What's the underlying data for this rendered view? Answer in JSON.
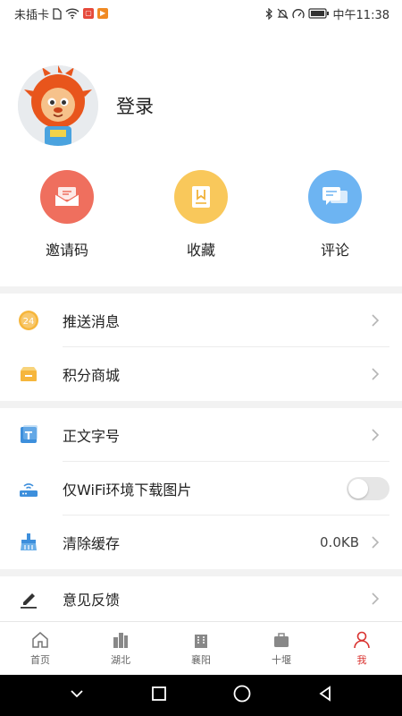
{
  "status_bar": {
    "carrier": "未插卡",
    "time": "中午11:38"
  },
  "profile": {
    "login_label": "登录"
  },
  "quick_actions": [
    {
      "label": "邀请码",
      "icon": "envelope-icon",
      "color": "#ef6f5e"
    },
    {
      "label": "收藏",
      "icon": "bookmark-icon",
      "color": "#f9c85b"
    },
    {
      "label": "评论",
      "icon": "chat-bubbles-icon",
      "color": "#6db4f2"
    }
  ],
  "menu": {
    "push": {
      "label": "推送消息",
      "badge": "24"
    },
    "points_mall": {
      "label": "积分商城"
    },
    "font_size": {
      "label": "正文字号",
      "icon_text": "T"
    },
    "wifi_images": {
      "label": "仅WiFi环境下载图片",
      "enabled": false
    },
    "clear_cache": {
      "label": "清除缓存",
      "value": "0.0KB"
    },
    "feedback": {
      "label": "意见反馈"
    }
  },
  "bottom_nav": [
    {
      "label": "首页",
      "icon": "home-icon",
      "active": false
    },
    {
      "label": "湖北",
      "icon": "city-buildings-icon",
      "active": false
    },
    {
      "label": "襄阳",
      "icon": "building-icon",
      "active": false
    },
    {
      "label": "十堰",
      "icon": "briefcase-icon",
      "active": false
    },
    {
      "label": "我",
      "icon": "person-icon",
      "active": true
    }
  ],
  "colors": {
    "accent": "#d9322f",
    "section_gap": "#f2f2f2"
  }
}
